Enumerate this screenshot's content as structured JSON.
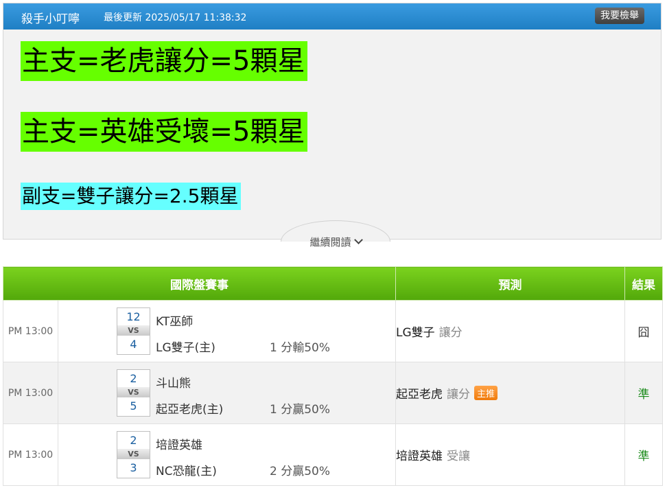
{
  "header": {
    "author": "殺手小叮嚀",
    "updated": "最後更新 2025/05/17 11:38:32",
    "report_button": "我要檢舉"
  },
  "picks": [
    "主支=老虎讓分=5顆星",
    "主支=英雄受壞=5顆星",
    "副支=雙子讓分=2.5顆星"
  ],
  "read_more": "繼續閱讀",
  "table": {
    "headers": {
      "match": "國際盤賽事",
      "prediction": "預測",
      "result": "結果"
    },
    "rows": [
      {
        "time": "PM 13:00",
        "away_score": "12",
        "home_score": "4",
        "vs": "VS",
        "away_team": "KT巫師",
        "home_team": "LG雙子(主)",
        "spread": "1 分輸50%",
        "pred_team": "LG雙子",
        "pred_type": "讓分",
        "badge": "",
        "result": "囧"
      },
      {
        "time": "PM 13:00",
        "away_score": "2",
        "home_score": "5",
        "vs": "VS",
        "away_team": "斗山熊",
        "home_team": "起亞老虎(主)",
        "spread": "1 分贏50%",
        "pred_team": "起亞老虎",
        "pred_type": "讓分",
        "badge": "主推",
        "result": "準"
      },
      {
        "time": "PM 13:00",
        "away_score": "2",
        "home_score": "3",
        "vs": "VS",
        "away_team": "培證英雄",
        "home_team": "NC恐龍(主)",
        "spread": "2 分贏50%",
        "pred_team": "培證英雄",
        "pred_type": "受讓",
        "badge": "",
        "result": "準"
      }
    ]
  },
  "colors": {
    "topbar": "#1f7fc4",
    "pick_highlight_main": "#66ff00",
    "pick_highlight_sub": "#66ffff",
    "table_header": "#52a80a",
    "result_correct": "#1a8a1a",
    "badge": "#f07b0c"
  }
}
